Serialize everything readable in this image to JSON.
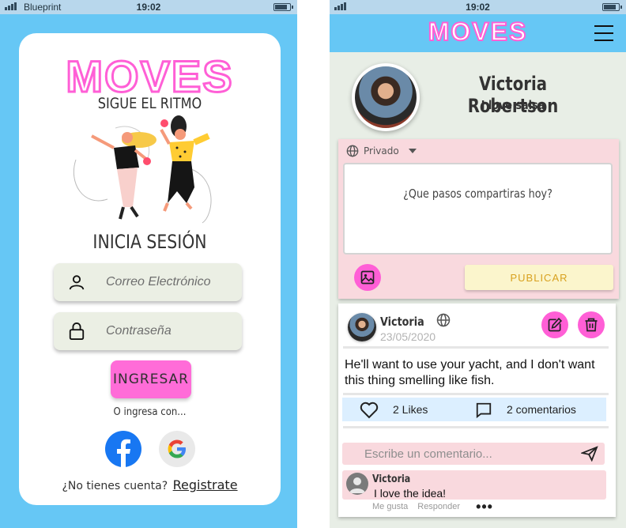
{
  "status_bar_left": {
    "carrier": "Blueprint",
    "time": "19:02"
  },
  "status_bar_right": {
    "time": "19:02"
  },
  "brand": {
    "name": "MOVES",
    "accent": "#ff5fd6",
    "sky": "#66c7f5"
  },
  "login": {
    "tagline": "SIGUE EL RITMO",
    "heading": "INICIA SESIÓN",
    "email_placeholder": "Correo Electrónico",
    "password_placeholder": "Contraseña",
    "submit_label": "INGRESAR",
    "or_text": "O ingresa con...",
    "no_account": "¿No tienes cuenta?",
    "signup_link": "Registrate"
  },
  "profile": {
    "name": "Victoria Robertson",
    "bio": "I love salsa"
  },
  "composer": {
    "privacy": "Privado",
    "placeholder": "¿Que pasos compartiras hoy?",
    "publish_label": "PUBLICAR"
  },
  "post": {
    "author": "Victoria",
    "date": "23/05/2020",
    "body": "He'll want to use your yacht, and I don't want this thing smelling like fish.",
    "likes": "2  Likes",
    "comments": "2 comentarios",
    "comment_placeholder": "Escribe un comentario...",
    "comment": {
      "author": "Victoria",
      "text": "I love the idea!"
    },
    "actions": {
      "like": "Me gusta",
      "reply": "Responder",
      "more": "•••"
    }
  }
}
